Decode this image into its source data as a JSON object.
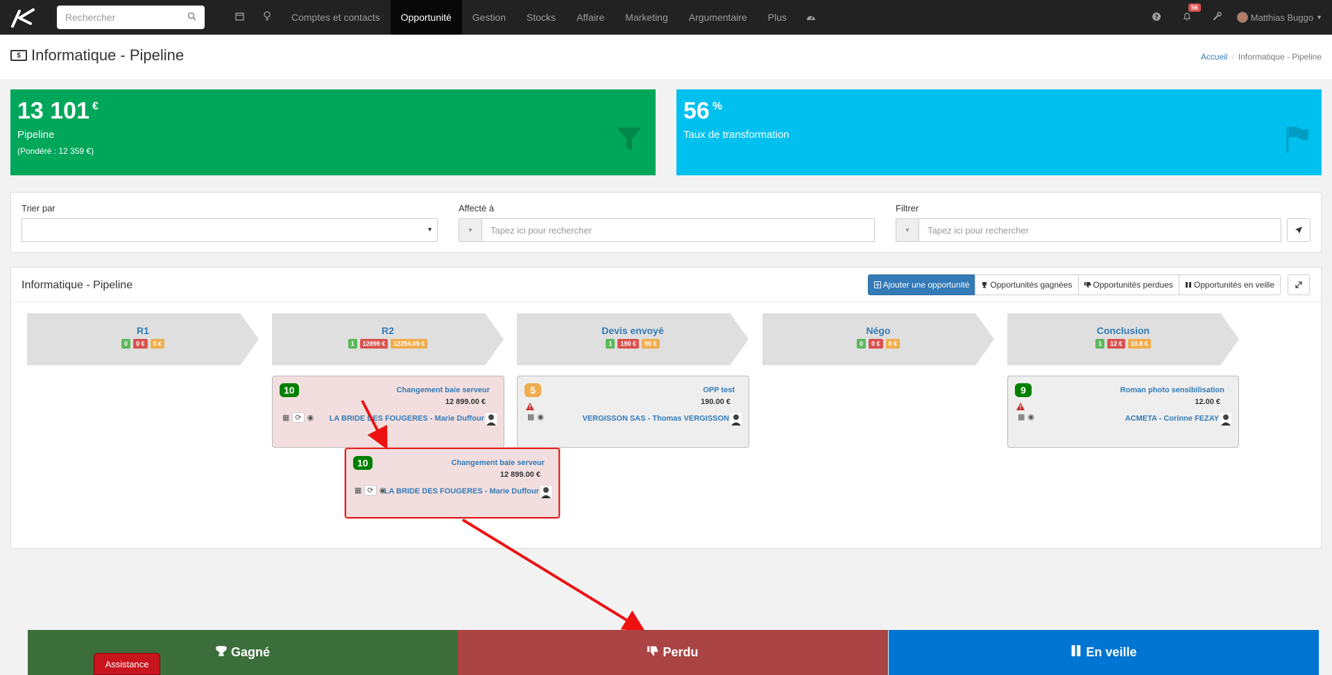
{
  "navbar": {
    "search_placeholder": "Rechercher",
    "menu": [
      "Comptes et contacts",
      "Opportunité",
      "Gestion",
      "Stocks",
      "Affaire",
      "Marketing",
      "Argumentaire",
      "Plus"
    ],
    "notifications_count": "56",
    "user_name": "Matthias Buggo"
  },
  "page": {
    "title": "Informatique - Pipeline",
    "breadcrumb_home": "Accueil",
    "breadcrumb_current": "Informatique - Pipeline"
  },
  "stats": {
    "pipeline_value": "13 101",
    "pipeline_currency": "€",
    "pipeline_label": "Pipeline",
    "pipeline_weighted": "(Pondéré : 12 359 €)",
    "rate_value": "56",
    "rate_unit": "%",
    "rate_label": "Taux de transformation"
  },
  "filters": {
    "sort_label": "Trier par",
    "assigned_label": "Affecté à",
    "assigned_placeholder": "Tapez ici pour rechercher",
    "filter_label": "Filtrer",
    "filter_placeholder": "Tapez ici pour rechercher"
  },
  "pipeline": {
    "title": "Informatique - Pipeline",
    "buttons": {
      "add": "Ajouter une opportunité",
      "won": "Opportunités gagnées",
      "lost": "Opportunités perdues",
      "watch": "Opportunités en veille"
    },
    "stages": [
      {
        "name": "R1",
        "count": "0",
        "amount": "0 €",
        "weighted": "0 €"
      },
      {
        "name": "R2",
        "count": "1",
        "amount": "12899 €",
        "weighted": "12254.05 €"
      },
      {
        "name": "Devis envoyé",
        "count": "1",
        "amount": "190 €",
        "weighted": "95 €"
      },
      {
        "name": "Négo",
        "count": "0",
        "amount": "0 €",
        "weighted": "0 €"
      },
      {
        "name": "Conclusion",
        "count": "1",
        "amount": "12 €",
        "weighted": "10.8 €"
      }
    ],
    "cards": [
      {
        "score": "10",
        "title": "Changement baie serveur",
        "amount": "12 899.00 €",
        "contact": "LA BRIDE DES FOUGERES - Marie Duffour"
      },
      {
        "score": "5",
        "title": "OPP test",
        "amount": "190.00 €",
        "contact": "VERGISSON SAS - Thomas VERGISSON"
      },
      {
        "score": "9",
        "title": "Roman photo sensibilisation",
        "amount": "12.00 €",
        "contact": "ACMETA - Corinne FEZAY"
      },
      {
        "score": "10",
        "title": "Changement baie serveur",
        "amount": "12 899.00 €",
        "contact": "LA BRIDE DES FOUGERES - Marie Duffour"
      }
    ]
  },
  "dropzones": {
    "won": "Gagné",
    "lost": "Perdu",
    "watch": "En veille"
  },
  "assistance": "Assistance",
  "colors": {
    "navbar": "#222222",
    "pipeline_green": "#00a65a",
    "rate_blue": "#00c0ef",
    "won": "#3c6e3c",
    "lost": "#aa4444",
    "watch": "#0075d1",
    "annotation_arrow": "#ee1111"
  }
}
